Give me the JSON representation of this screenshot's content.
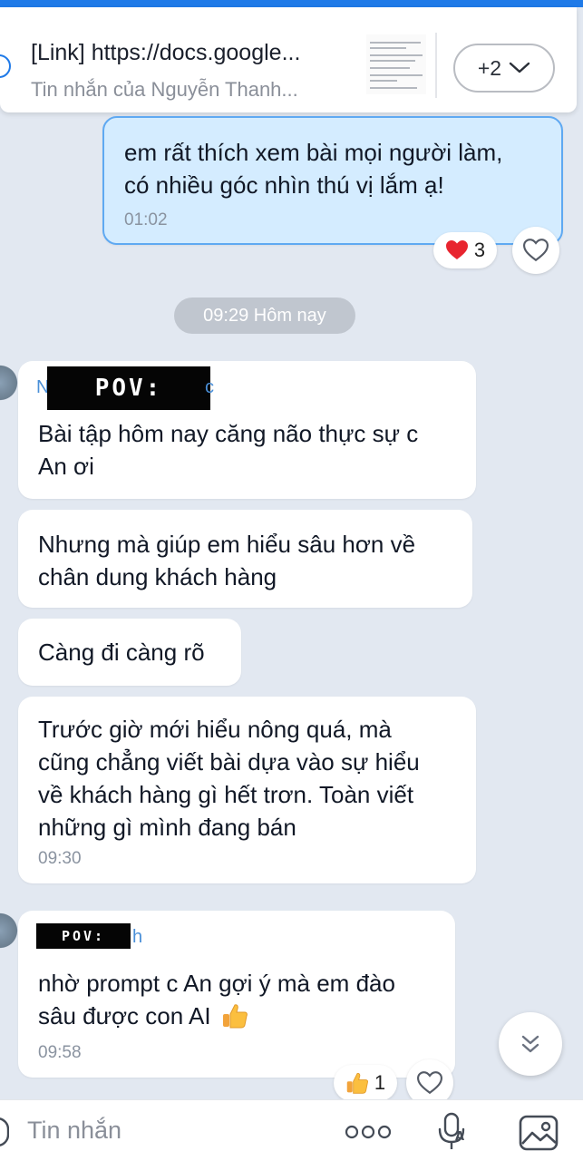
{
  "pinned": {
    "title": "[Link] https://docs.google...",
    "subtitle": "Tin nhắn của Nguyễn Thanh...",
    "more_label": "+2"
  },
  "messages": [
    {
      "id": "m1",
      "direction": "outgoing",
      "text_lines": [
        "em rất thích xem bài mọi người làm,",
        "có nhiều góc nhìn thú vị lắm ạ!"
      ],
      "time": "01:02",
      "reaction": {
        "emoji": "heart",
        "count": "3"
      }
    },
    {
      "id": "m2",
      "direction": "incoming",
      "sender_redacted_label": "POV:",
      "sender_prefix": "N",
      "sender_suffix": "c",
      "text_lines": [
        "Bài tập hôm nay căng não thực sự c",
        "An ơi"
      ]
    },
    {
      "id": "m3",
      "direction": "incoming",
      "text_lines": [
        "Nhưng mà giúp em hiểu sâu hơn về",
        "chân dung khách hàng"
      ]
    },
    {
      "id": "m4",
      "direction": "incoming",
      "text_lines": [
        "Càng đi càng rõ"
      ]
    },
    {
      "id": "m5",
      "direction": "incoming",
      "text_lines": [
        "Trước giờ mới hiểu nông quá, mà",
        "cũng chẳng viết bài dựa vào sự hiểu",
        "về khách hàng gì hết trơn. Toàn viết",
        "những gì mình đang bán"
      ],
      "time": "09:30"
    },
    {
      "id": "m6",
      "direction": "incoming",
      "sender_redacted_label": "POV:",
      "sender_suffix": "h",
      "text_lines": [
        "nhờ prompt c An gợi ý mà em đào",
        "sâu được con AI"
      ],
      "time": "09:58",
      "reaction": {
        "emoji": "thumbs-up",
        "count": "1"
      }
    }
  ],
  "date_separator": "09:29 Hôm nay",
  "input": {
    "placeholder": "Tin nhắn"
  },
  "colors": {
    "accent": "#1f7ae8",
    "chat_background": "#e2e8f1",
    "outgoing_bubble": "#d4ecff",
    "incoming_bubble": "#ffffff"
  }
}
